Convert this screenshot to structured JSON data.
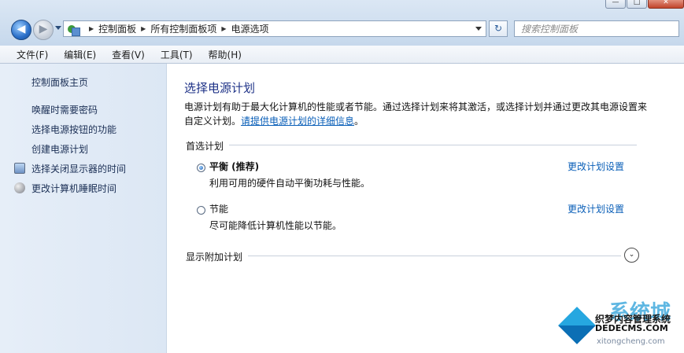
{
  "window": {
    "min_glyph": "—",
    "max_glyph": "□",
    "close_glyph": "✕"
  },
  "nav": {
    "back_glyph": "◀",
    "forward_glyph": "▶"
  },
  "address": {
    "crumbs": [
      "控制面板",
      "所有控制面板项",
      "电源选项"
    ],
    "separator": "▶"
  },
  "refresh_glyph": "↻",
  "search": {
    "placeholder": "搜索控制面板"
  },
  "menu": [
    "文件(F)",
    "编辑(E)",
    "查看(V)",
    "工具(T)",
    "帮助(H)"
  ],
  "sidebar": {
    "home": "控制面板主页",
    "links": [
      "唤醒时需要密码",
      "选择电源按钮的功能",
      "创建电源计划",
      "选择关闭显示器的时间",
      "更改计算机睡眠时间"
    ],
    "icons": [
      "monitor-icon",
      "moon-icon"
    ]
  },
  "main": {
    "title": "选择电源计划",
    "desc_text": "电源计划有助于最大化计算机的性能或者节能。通过选择计划来将其激活，或选择计划并通过更改其电源设置来自定义计划。",
    "desc_link": "请提供电源计划的详细信息",
    "desc_end": "。",
    "preferred_label": "首选计划",
    "plans": [
      {
        "name": "平衡 (推荐)",
        "desc": "利用可用的硬件自动平衡功耗与性能。",
        "link": "更改计划设置",
        "selected": true
      },
      {
        "name": "节能",
        "desc": "尽可能降低计算机性能以节能。",
        "link": "更改计划设置",
        "selected": false
      }
    ],
    "additional_label": "显示附加计划",
    "expand_glyph": "⌄"
  },
  "watermark": {
    "big": "系统城",
    "line1": "织梦内容管理系统",
    "line2": "DEDECMS.COM",
    "line3": "xitongcheng.com"
  },
  "colors": {
    "link": "#0a5fb8",
    "heading": "#1e3287",
    "sidebar_bg": "#dce7f4"
  }
}
